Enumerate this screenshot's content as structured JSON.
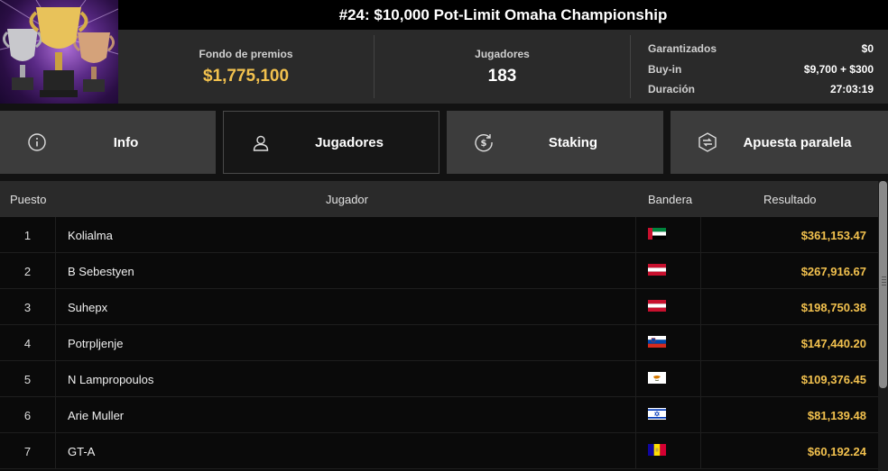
{
  "header": {
    "title": "#24: $10,000 Pot-Limit Omaha Championship",
    "prize_pool": {
      "label": "Fondo de premios",
      "value": "$1,775,100"
    },
    "players": {
      "label": "Jugadores",
      "value": "183"
    },
    "details": [
      {
        "label": "Garantizados",
        "value": "$0"
      },
      {
        "label": "Buy-in",
        "value": "$9,700 + $300"
      },
      {
        "label": "Duración",
        "value": "27:03:19"
      }
    ]
  },
  "tabs": [
    {
      "label": "Info",
      "icon": "info-icon",
      "active": false
    },
    {
      "label": "Jugadores",
      "icon": "user-icon",
      "active": true
    },
    {
      "label": "Staking",
      "icon": "dollar-coin-icon",
      "active": false
    },
    {
      "label": "Apuesta paralela",
      "icon": "side-bet-icon",
      "active": false
    }
  ],
  "table": {
    "columns": {
      "rank": "Puesto",
      "player": "Jugador",
      "flag": "Bandera",
      "result": "Resultado"
    },
    "rows": [
      {
        "rank": "1",
        "player": "Kolialma",
        "flag": "uae-flag",
        "result": "$361,153.47"
      },
      {
        "rank": "2",
        "player": "B Sebestyen",
        "flag": "austria-flag",
        "result": "$267,916.67"
      },
      {
        "rank": "3",
        "player": "Suhepx",
        "flag": "austria-flag",
        "result": "$198,750.38"
      },
      {
        "rank": "4",
        "player": "Potrpljenje",
        "flag": "slovenia-flag",
        "result": "$147,440.20"
      },
      {
        "rank": "5",
        "player": "N Lampropoulos",
        "flag": "cyprus-flag",
        "result": "$109,376.45"
      },
      {
        "rank": "6",
        "player": "Arie Muller",
        "flag": "israel-flag",
        "result": "$81,139.48"
      },
      {
        "rank": "7",
        "player": "GT-A",
        "flag": "andorra-flag",
        "result": "$60,192.24"
      }
    ]
  },
  "colors": {
    "gold": "#f2c14e",
    "background": "#121212",
    "tab": "#3c3c3c",
    "tab_active": "#161616"
  }
}
